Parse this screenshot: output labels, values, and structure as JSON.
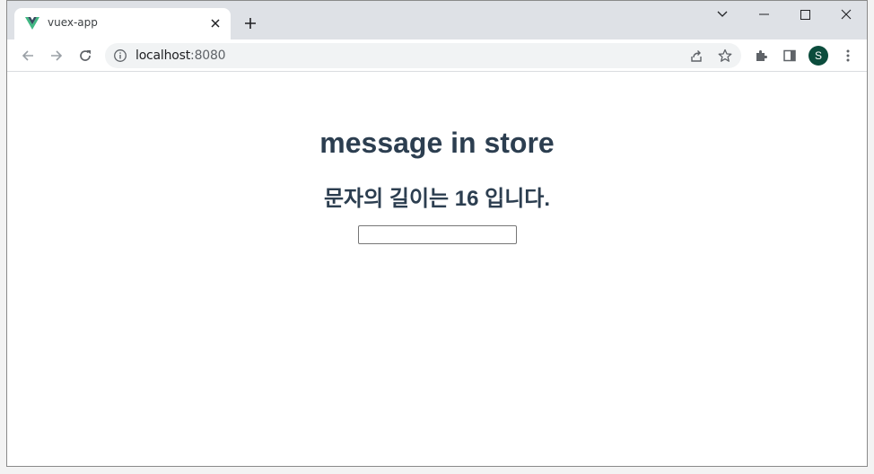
{
  "browser": {
    "tab": {
      "title": "vuex-app",
      "favicon": "vue-logo-icon"
    },
    "address": {
      "host": "localhost",
      "port": ":8080"
    },
    "profile_initial": "S",
    "accent_colors": {
      "tabstrip": "#dee1e6",
      "avatar": "#0b4c3c",
      "vue_green": "#41b883",
      "vue_dark": "#35495e"
    }
  },
  "page": {
    "heading": "message in store",
    "subheading": "문자의 길이는 16 입니다.",
    "input_value": "",
    "text_color": "#2c3e50"
  }
}
